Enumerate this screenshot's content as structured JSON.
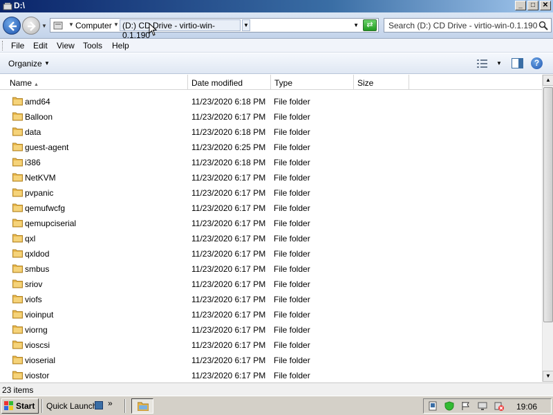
{
  "window": {
    "title": "D:\\"
  },
  "address": {
    "crumb_computer": "Computer",
    "current": "(D:) CD Drive - virtio-win-0.1.190"
  },
  "search": {
    "placeholder": "Search (D:) CD Drive - virtio-win-0.1.190"
  },
  "menu": {
    "file": "File",
    "edit": "Edit",
    "view": "View",
    "tools": "Tools",
    "help": "Help"
  },
  "command_bar": {
    "organize": "Organize"
  },
  "columns": {
    "name": "Name",
    "date": "Date modified",
    "type": "Type",
    "size": "Size"
  },
  "files": [
    {
      "name": "amd64",
      "date": "11/23/2020 6:18 PM",
      "type": "File folder"
    },
    {
      "name": "Balloon",
      "date": "11/23/2020 6:17 PM",
      "type": "File folder"
    },
    {
      "name": "data",
      "date": "11/23/2020 6:18 PM",
      "type": "File folder"
    },
    {
      "name": "guest-agent",
      "date": "11/23/2020 6:25 PM",
      "type": "File folder"
    },
    {
      "name": "i386",
      "date": "11/23/2020 6:18 PM",
      "type": "File folder"
    },
    {
      "name": "NetKVM",
      "date": "11/23/2020 6:17 PM",
      "type": "File folder"
    },
    {
      "name": "pvpanic",
      "date": "11/23/2020 6:17 PM",
      "type": "File folder"
    },
    {
      "name": "qemufwcfg",
      "date": "11/23/2020 6:17 PM",
      "type": "File folder"
    },
    {
      "name": "qemupciserial",
      "date": "11/23/2020 6:17 PM",
      "type": "File folder"
    },
    {
      "name": "qxl",
      "date": "11/23/2020 6:17 PM",
      "type": "File folder"
    },
    {
      "name": "qxldod",
      "date": "11/23/2020 6:17 PM",
      "type": "File folder"
    },
    {
      "name": "smbus",
      "date": "11/23/2020 6:17 PM",
      "type": "File folder"
    },
    {
      "name": "sriov",
      "date": "11/23/2020 6:17 PM",
      "type": "File folder"
    },
    {
      "name": "viofs",
      "date": "11/23/2020 6:17 PM",
      "type": "File folder"
    },
    {
      "name": "vioinput",
      "date": "11/23/2020 6:17 PM",
      "type": "File folder"
    },
    {
      "name": "viorng",
      "date": "11/23/2020 6:17 PM",
      "type": "File folder"
    },
    {
      "name": "vioscsi",
      "date": "11/23/2020 6:17 PM",
      "type": "File folder"
    },
    {
      "name": "vioserial",
      "date": "11/23/2020 6:17 PM",
      "type": "File folder"
    },
    {
      "name": "viostor",
      "date": "11/23/2020 6:17 PM",
      "type": "File folder"
    }
  ],
  "status": {
    "items_count": "23 items"
  },
  "taskbar": {
    "start": "Start",
    "quick_launch": "Quick Launch",
    "more": "»",
    "clock": "19:06"
  },
  "icons": {
    "folder": "folder-icon",
    "drive": "cd-drive-icon",
    "back": "back-arrow-icon",
    "forward": "forward-arrow-icon",
    "refresh": "refresh-icon",
    "search": "search-icon",
    "views": "views-icon",
    "preview_pane": "preview-pane-icon",
    "help": "help-icon"
  },
  "colors": {
    "title_bar": "#0a246a",
    "folder": "#e8b64a",
    "taskbar": "#d4d0c8"
  }
}
